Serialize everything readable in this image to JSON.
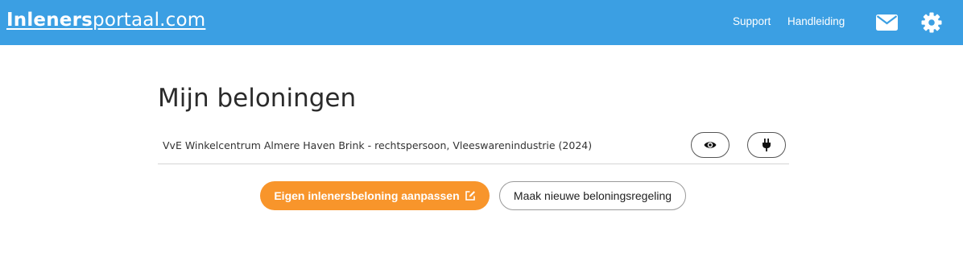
{
  "header": {
    "logo_bold": "Inleners",
    "logo_rest": "portaal.com",
    "links": [
      "Support",
      "Handleiding"
    ],
    "icons": [
      "mail-icon",
      "gear-icon"
    ],
    "background_color": "#3b9fe3"
  },
  "main": {
    "title": "Mijn beloningen",
    "rows": [
      {
        "label": "VvE Winkelcentrum Almere Haven Brink - rechtspersoon, Vleeswarenindustrie (2024)",
        "actions": [
          "eye-icon",
          "plug-icon"
        ]
      }
    ],
    "primary_button": {
      "label": "Eigen inlenersbeloning aanpassen",
      "icon": "edit-icon",
      "color": "#f8952b"
    },
    "secondary_button": {
      "label": "Maak nieuwe beloningsregeling"
    }
  }
}
